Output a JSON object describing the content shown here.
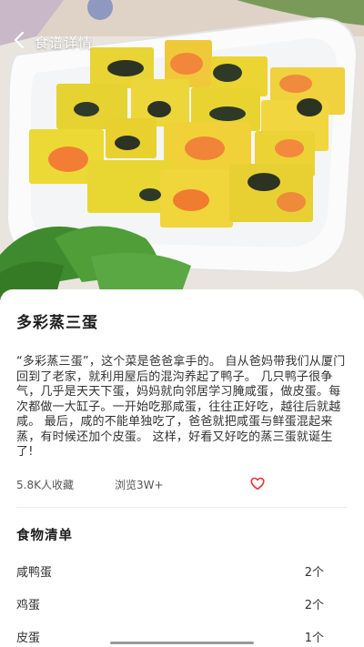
{
  "header": {
    "title": "食谱详情",
    "back_icon": "chevron-left-icon"
  },
  "recipe": {
    "name": "多彩蒸三蛋",
    "description": "“多彩蒸三蛋”，这个菜是爸爸拿手的。 自从爸妈带我们从厦门回到了老家，就利用屋后的混沟养起了鸭子。 几只鸭子很争气，几乎是天天下蛋，妈妈就向邻居学习腌咸蛋，做皮蛋。每次都做一大缸子。一开始吃那咸蛋，往往正好吃，越往后就越咸。 最后，咸的不能单独吃了，爸爸就把咸蛋与鲜蛋混起来蒸，有时候还加个皮蛋。 这样，好看又好吃的蒸三蛋就诞生了!",
    "favorites": "5.8K人收藏",
    "views": "浏览3W+",
    "heart_icon": "heart-outline-icon",
    "accent_color": "#e53935"
  },
  "ingredients": {
    "title": "食物清单",
    "items": [
      {
        "name": "咸鸭蛋",
        "amount": "2个"
      },
      {
        "name": "鸡蛋",
        "amount": "2个"
      },
      {
        "name": "皮蛋",
        "amount": "1个"
      }
    ]
  }
}
